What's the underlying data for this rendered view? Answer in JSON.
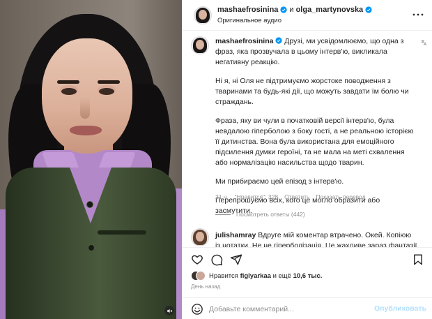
{
  "header": {
    "username": "mashaefrosinina",
    "and_text": "и",
    "collab_username": "olga_martynovska",
    "subtitle": "Оригинальное аудио"
  },
  "caption": {
    "username": "mashaefrosinina",
    "paragraphs": [
      "Друзі, ми усвідомлюємо, що одна з фраз, яка прозвучала в цьому інтерв'ю, викликала негативну реакцію.",
      "Ні я, ні Оля не підтримуємо жорстоке поводження з тваринами та будь-які дії, що можуть завдати їм болю чи страждань.",
      "Фраза, яку ви чули в початковій версії інтерв'ю, була невдалою гіперболою з боку гості, а не реальною історією її дитинства. Вона була використана для емоційного підсилення думки героїні, та не мала на меті схвалення або нормалізацію насильства щодо тварин.",
      "Ми прибираємо цей епізод з інтерв'ю.",
      "Перепрошуємо всіх, кого це могло образити або засмутити."
    ],
    "time": "21 ч.",
    "likes": "\"Нравится\": 328",
    "reply": "Ответить",
    "translation": "Показать перевод",
    "view_replies": "Посмотреть ответы (442)"
  },
  "comment2": {
    "username": "julishamray",
    "text": "Вдруге мій коментар втрачено. Окей. Копіюю із нотатки. Не не гіперболізація. Це жахливе зараз фантазії А"
  },
  "likes_line": {
    "prefix": "Нравится",
    "user": "figlyarkaa",
    "suffix": "и ещё",
    "count": "10,6 тыс."
  },
  "date": "День назад",
  "composer": {
    "placeholder": "Добавьте комментарий...",
    "publish": "Опубликовать"
  },
  "colors": {
    "verified": "#0095f6",
    "publish_disabled": "#b2dffc",
    "muted_text": "#8e8e8e"
  }
}
